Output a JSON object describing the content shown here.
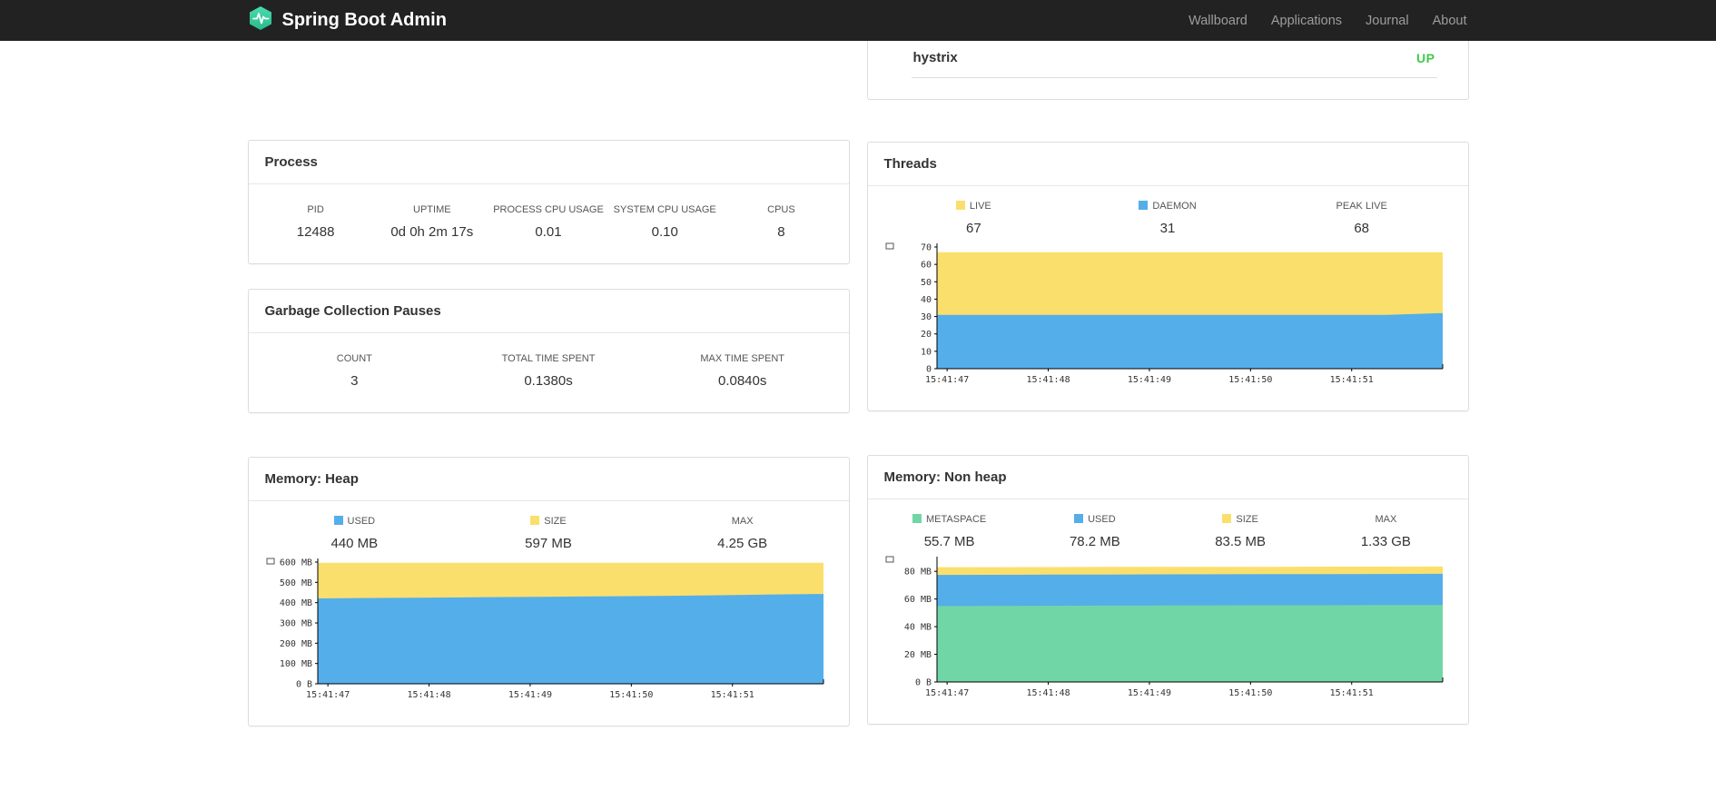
{
  "navbar": {
    "brand": "Spring Boot Admin",
    "items": [
      {
        "label": "Wallboard"
      },
      {
        "label": "Applications"
      },
      {
        "label": "Journal"
      },
      {
        "label": "About"
      }
    ]
  },
  "health": {
    "rows": [
      {
        "name": "hystrix",
        "status": "UP",
        "status_color": "#3ecb4c"
      }
    ]
  },
  "process": {
    "title": "Process",
    "metrics": [
      {
        "label": "PID",
        "value": "12488"
      },
      {
        "label": "UPTIME",
        "value": "0d 0h 2m 17s"
      },
      {
        "label": "PROCESS CPU USAGE",
        "value": "0.01"
      },
      {
        "label": "SYSTEM CPU USAGE",
        "value": "0.10"
      },
      {
        "label": "CPUS",
        "value": "8"
      }
    ]
  },
  "gc": {
    "title": "Garbage Collection Pauses",
    "metrics": [
      {
        "label": "COUNT",
        "value": "3"
      },
      {
        "label": "TOTAL TIME SPENT",
        "value": "0.1380s"
      },
      {
        "label": "MAX TIME SPENT",
        "value": "0.0840s"
      }
    ]
  },
  "threads": {
    "title": "Threads",
    "legend": [
      {
        "label": "LIVE",
        "value": "67",
        "color": "#fbdf6d"
      },
      {
        "label": "DAEMON",
        "value": "31",
        "color": "#54aeea"
      },
      {
        "label": "PEAK LIVE",
        "value": "68",
        "color": null
      }
    ]
  },
  "heap": {
    "title": "Memory: Heap",
    "legend": [
      {
        "label": "USED",
        "value": "440 MB",
        "color": "#54aeea"
      },
      {
        "label": "SIZE",
        "value": "597 MB",
        "color": "#fbdf6d"
      },
      {
        "label": "MAX",
        "value": "4.25 GB",
        "color": null
      }
    ]
  },
  "nonheap": {
    "title": "Memory: Non heap",
    "legend": [
      {
        "label": "METASPACE",
        "value": "55.7 MB",
        "color": "#71d6a5"
      },
      {
        "label": "USED",
        "value": "78.2 MB",
        "color": "#54aeea"
      },
      {
        "label": "SIZE",
        "value": "83.5 MB",
        "color": "#fbdf6d"
      },
      {
        "label": "MAX",
        "value": "1.33 GB",
        "color": null
      }
    ]
  },
  "colors": {
    "navbar_bg": "#222222",
    "status_up": "#3ecb4c",
    "series_yellow": "#fbdf6d",
    "series_blue": "#54aeea",
    "series_green": "#71d6a5",
    "logo_teal": "#3fcda4"
  },
  "chart_data": [
    {
      "id": "threads",
      "type": "area",
      "title": "Threads",
      "ymax": 70,
      "yticks": [
        {
          "v": 0,
          "label": "0"
        },
        {
          "v": 10,
          "label": "10"
        },
        {
          "v": 20,
          "label": "20"
        },
        {
          "v": 30,
          "label": "30"
        },
        {
          "v": 40,
          "label": "40"
        },
        {
          "v": 50,
          "label": "50"
        },
        {
          "v": 60,
          "label": "60"
        },
        {
          "v": 70,
          "label": "70"
        }
      ],
      "xticks": [
        "15:41:47",
        "15:41:48",
        "15:41:49",
        "15:41:50",
        "15:41:51"
      ],
      "series": [
        {
          "name": "live",
          "color": "#fbdf6d",
          "values": [
            67,
            67,
            67,
            67,
            67,
            67,
            67,
            67,
            67,
            67
          ]
        },
        {
          "name": "daemon",
          "color": "#54aeea",
          "values": [
            31,
            31,
            31,
            31,
            31,
            31,
            31,
            31,
            31,
            32
          ]
        }
      ]
    },
    {
      "id": "heap",
      "type": "area",
      "title": "Memory: Heap",
      "ymax": 600,
      "yticks": [
        {
          "v": 0,
          "label": "0 B"
        },
        {
          "v": 100,
          "label": "100 MB"
        },
        {
          "v": 200,
          "label": "200 MB"
        },
        {
          "v": 300,
          "label": "300 MB"
        },
        {
          "v": 400,
          "label": "400 MB"
        },
        {
          "v": 500,
          "label": "500 MB"
        },
        {
          "v": 600,
          "label": "600 MB"
        }
      ],
      "xticks": [
        "15:41:47",
        "15:41:48",
        "15:41:49",
        "15:41:50",
        "15:41:51"
      ],
      "series": [
        {
          "name": "size",
          "color": "#fbdf6d",
          "values": [
            597,
            597,
            597,
            597,
            597,
            597,
            597,
            597,
            597,
            597
          ]
        },
        {
          "name": "used",
          "color": "#54aeea",
          "values": [
            421,
            423,
            425,
            427,
            429,
            431,
            433,
            436,
            440,
            443
          ]
        }
      ]
    },
    {
      "id": "nonheap",
      "type": "area",
      "title": "Memory: Non heap",
      "ymax": 88,
      "yticks": [
        {
          "v": 0,
          "label": "0 B"
        },
        {
          "v": 20,
          "label": "20 MB"
        },
        {
          "v": 40,
          "label": "40 MB"
        },
        {
          "v": 60,
          "label": "60 MB"
        },
        {
          "v": 80,
          "label": "80 MB"
        }
      ],
      "xticks": [
        "15:41:47",
        "15:41:48",
        "15:41:49",
        "15:41:50",
        "15:41:51"
      ],
      "series": [
        {
          "name": "size",
          "color": "#fbdf6d",
          "values": [
            83.0,
            83.0,
            83.1,
            83.2,
            83.2,
            83.3,
            83.3,
            83.4,
            83.4,
            83.5
          ]
        },
        {
          "name": "used",
          "color": "#54aeea",
          "values": [
            77.4,
            77.5,
            77.6,
            77.7,
            77.8,
            77.9,
            78.0,
            78.0,
            78.1,
            78.2
          ]
        },
        {
          "name": "metaspace",
          "color": "#71d6a5",
          "values": [
            54.9,
            55.0,
            55.1,
            55.2,
            55.3,
            55.4,
            55.5,
            55.5,
            55.6,
            55.7
          ]
        }
      ]
    }
  ]
}
